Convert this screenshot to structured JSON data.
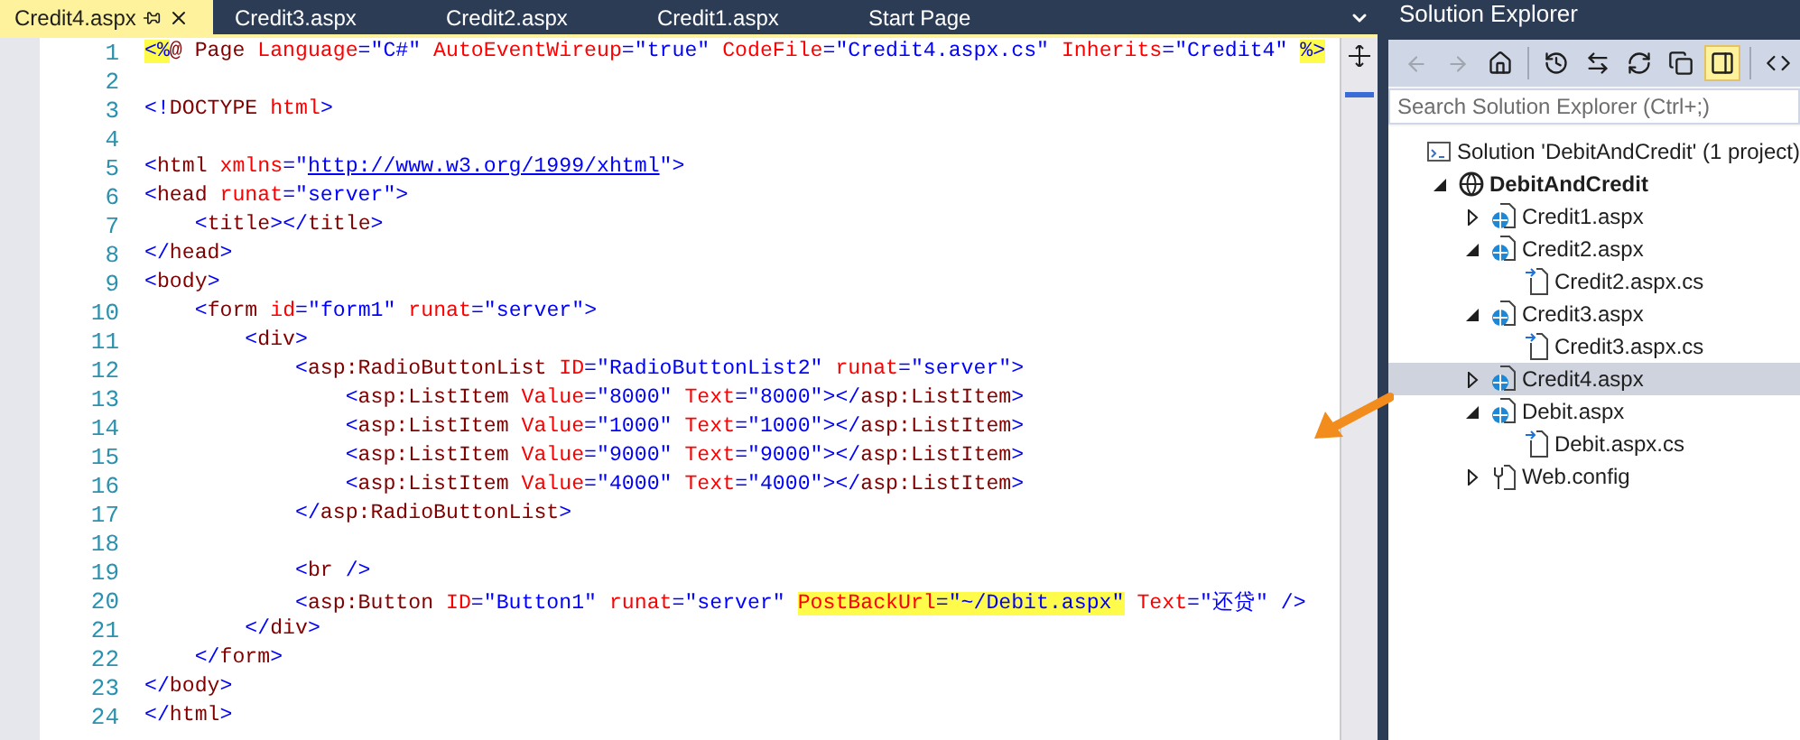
{
  "tabs": [
    {
      "label": "Credit4.aspx",
      "selected": true
    },
    {
      "label": "Credit3.aspx",
      "selected": false
    },
    {
      "label": "Credit2.aspx",
      "selected": false
    },
    {
      "label": "Credit1.aspx",
      "selected": false
    },
    {
      "label": "Start Page",
      "selected": false
    }
  ],
  "editor": {
    "lines": [
      {
        "number": "1",
        "tokens": [
          {
            "t": "<%",
            "kind": "delim",
            "hl": true
          },
          {
            "t": "@ Page ",
            "kind": "tag"
          },
          {
            "t": "Language",
            "kind": "attr"
          },
          {
            "t": "=\"C#\" ",
            "kind": "value"
          },
          {
            "t": "AutoEventWireup",
            "kind": "attr"
          },
          {
            "t": "=\"true\" ",
            "kind": "value"
          },
          {
            "t": "CodeFile",
            "kind": "attr"
          },
          {
            "t": "=\"Credit4.aspx.cs\" ",
            "kind": "value"
          },
          {
            "t": "Inherits",
            "kind": "attr"
          },
          {
            "t": "=\"Credit4\" ",
            "kind": "value"
          },
          {
            "t": "%>",
            "kind": "delim",
            "hl": true
          }
        ]
      },
      {
        "number": "2"
      },
      {
        "number": "3",
        "tokens": [
          {
            "t": "<!",
            "kind": "delim"
          },
          {
            "t": "DOCTYPE ",
            "kind": "tag"
          },
          {
            "t": "html",
            "kind": "attr"
          },
          {
            "t": ">",
            "kind": "delim"
          }
        ]
      },
      {
        "number": "4"
      },
      {
        "number": "5",
        "tokens": [
          {
            "t": "<",
            "kind": "delim"
          },
          {
            "t": "html ",
            "kind": "tag"
          },
          {
            "t": "xmlns",
            "kind": "attr"
          },
          {
            "t": "=\"",
            "kind": "value"
          },
          {
            "t": "http://www.w3.org/1999/xhtml",
            "kind": "link"
          },
          {
            "t": "\">",
            "kind": "value"
          }
        ]
      },
      {
        "number": "6",
        "tokens": [
          {
            "t": "<",
            "kind": "delim"
          },
          {
            "t": "head ",
            "kind": "tag"
          },
          {
            "t": "runat",
            "kind": "attr"
          },
          {
            "t": "=\"server\">",
            "kind": "value"
          }
        ]
      },
      {
        "number": "7",
        "tokens": [
          {
            "t": "    <",
            "kind": "delim"
          },
          {
            "t": "title",
            "kind": "tag"
          },
          {
            "t": "></",
            "kind": "delim"
          },
          {
            "t": "title",
            "kind": "tag"
          },
          {
            "t": ">",
            "kind": "delim"
          }
        ]
      },
      {
        "number": "8",
        "tokens": [
          {
            "t": "</",
            "kind": "delim"
          },
          {
            "t": "head",
            "kind": "tag"
          },
          {
            "t": ">",
            "kind": "delim"
          }
        ]
      },
      {
        "number": "9",
        "tokens": [
          {
            "t": "<",
            "kind": "delim"
          },
          {
            "t": "body",
            "kind": "tag"
          },
          {
            "t": ">",
            "kind": "delim"
          }
        ]
      },
      {
        "number": "10",
        "tokens": [
          {
            "t": "    <",
            "kind": "delim"
          },
          {
            "t": "form ",
            "kind": "tag"
          },
          {
            "t": "id",
            "kind": "attr"
          },
          {
            "t": "=\"form1\" ",
            "kind": "value"
          },
          {
            "t": "runat",
            "kind": "attr"
          },
          {
            "t": "=\"server\">",
            "kind": "value"
          }
        ]
      },
      {
        "number": "11",
        "tokens": [
          {
            "t": "        <",
            "kind": "delim"
          },
          {
            "t": "div",
            "kind": "tag"
          },
          {
            "t": ">",
            "kind": "delim"
          }
        ]
      },
      {
        "number": "12",
        "tokens": [
          {
            "t": "            <",
            "kind": "delim"
          },
          {
            "t": "asp:RadioButtonList ",
            "kind": "tag"
          },
          {
            "t": "ID",
            "kind": "attr"
          },
          {
            "t": "=\"RadioButtonList2\" ",
            "kind": "value"
          },
          {
            "t": "runat",
            "kind": "attr"
          },
          {
            "t": "=\"server\">",
            "kind": "value"
          }
        ]
      },
      {
        "number": "13",
        "tokens": [
          {
            "t": "                <",
            "kind": "delim"
          },
          {
            "t": "asp:ListItem ",
            "kind": "tag"
          },
          {
            "t": "Value",
            "kind": "attr"
          },
          {
            "t": "=\"8000\" ",
            "kind": "value"
          },
          {
            "t": "Text",
            "kind": "attr"
          },
          {
            "t": "=\"8000\"></",
            "kind": "value"
          },
          {
            "t": "asp:ListItem",
            "kind": "tag"
          },
          {
            "t": ">",
            "kind": "delim"
          }
        ]
      },
      {
        "number": "14",
        "tokens": [
          {
            "t": "                <",
            "kind": "delim"
          },
          {
            "t": "asp:ListItem ",
            "kind": "tag"
          },
          {
            "t": "Value",
            "kind": "attr"
          },
          {
            "t": "=\"1000\" ",
            "kind": "value"
          },
          {
            "t": "Text",
            "kind": "attr"
          },
          {
            "t": "=\"1000\"></",
            "kind": "value"
          },
          {
            "t": "asp:ListItem",
            "kind": "tag"
          },
          {
            "t": ">",
            "kind": "delim"
          }
        ]
      },
      {
        "number": "15",
        "tokens": [
          {
            "t": "                <",
            "kind": "delim"
          },
          {
            "t": "asp:ListItem ",
            "kind": "tag"
          },
          {
            "t": "Value",
            "kind": "attr"
          },
          {
            "t": "=\"9000\" ",
            "kind": "value"
          },
          {
            "t": "Text",
            "kind": "attr"
          },
          {
            "t": "=\"9000\"></",
            "kind": "value"
          },
          {
            "t": "asp:ListItem",
            "kind": "tag"
          },
          {
            "t": ">",
            "kind": "delim"
          }
        ]
      },
      {
        "number": "16",
        "tokens": [
          {
            "t": "                <",
            "kind": "delim"
          },
          {
            "t": "asp:ListItem ",
            "kind": "tag"
          },
          {
            "t": "Value",
            "kind": "attr"
          },
          {
            "t": "=\"4000\" ",
            "kind": "value"
          },
          {
            "t": "Text",
            "kind": "attr"
          },
          {
            "t": "=\"4000\"></",
            "kind": "value"
          },
          {
            "t": "asp:ListItem",
            "kind": "tag"
          },
          {
            "t": ">",
            "kind": "delim"
          }
        ]
      },
      {
        "number": "17",
        "tokens": [
          {
            "t": "            </",
            "kind": "delim"
          },
          {
            "t": "asp:RadioButtonList",
            "kind": "tag"
          },
          {
            "t": ">",
            "kind": "delim"
          }
        ]
      },
      {
        "number": "18"
      },
      {
        "number": "19",
        "tokens": [
          {
            "t": "            <",
            "kind": "delim"
          },
          {
            "t": "br ",
            "kind": "tag"
          },
          {
            "t": "/>",
            "kind": "delim"
          }
        ]
      },
      {
        "number": "20",
        "tokens": [
          {
            "t": "            <",
            "kind": "delim"
          },
          {
            "t": "asp:Button ",
            "kind": "tag"
          },
          {
            "t": "ID",
            "kind": "attr"
          },
          {
            "t": "=\"Button1\" ",
            "kind": "value"
          },
          {
            "t": "runat",
            "kind": "attr"
          },
          {
            "t": "=\"server\" ",
            "kind": "value"
          },
          {
            "t": "PostBackUrl",
            "kind": "attr",
            "hl": true
          },
          {
            "t": "=\"~/Debit.aspx\"",
            "kind": "value",
            "hl": true
          },
          {
            "t": " Text",
            "kind": "attr"
          },
          {
            "t": "=\"还贷\" />",
            "kind": "value"
          }
        ]
      },
      {
        "number": "21",
        "tokens": [
          {
            "t": "        </",
            "kind": "delim"
          },
          {
            "t": "div",
            "kind": "tag"
          },
          {
            "t": ">",
            "kind": "delim"
          }
        ]
      },
      {
        "number": "22",
        "tokens": [
          {
            "t": "    </",
            "kind": "delim"
          },
          {
            "t": "form",
            "kind": "tag"
          },
          {
            "t": ">",
            "kind": "delim"
          }
        ]
      },
      {
        "number": "23",
        "tokens": [
          {
            "t": "</",
            "kind": "delim"
          },
          {
            "t": "body",
            "kind": "tag"
          },
          {
            "t": ">",
            "kind": "delim"
          }
        ]
      },
      {
        "number": "24",
        "tokens": [
          {
            "t": "</",
            "kind": "delim"
          },
          {
            "t": "html",
            "kind": "tag"
          },
          {
            "t": ">",
            "kind": "delim"
          }
        ]
      }
    ]
  },
  "solution_explorer": {
    "title": "Solution Explorer",
    "search": {
      "placeholder": "Search Solution Explorer (Ctrl+;)"
    },
    "tree": [
      {
        "label": "Solution 'DebitAndCredit' (1 project)",
        "kind": "solution",
        "selected": false,
        "children": [
          {
            "label": "DebitAndCredit",
            "kind": "project",
            "expanded": true,
            "selected": false,
            "children": [
              {
                "label": "Credit1.aspx",
                "kind": "page",
                "expanded": false,
                "selected": false
              },
              {
                "label": "Credit2.aspx",
                "kind": "page",
                "expanded": true,
                "selected": false,
                "children": [
                  {
                    "label": "Credit2.aspx.cs",
                    "kind": "code",
                    "selected": false
                  }
                ]
              },
              {
                "label": "Credit3.aspx",
                "kind": "page",
                "expanded": true,
                "selected": false,
                "children": [
                  {
                    "label": "Credit3.aspx.cs",
                    "kind": "code",
                    "selected": false
                  }
                ]
              },
              {
                "label": "Credit4.aspx",
                "kind": "page",
                "expanded": false,
                "selected": true
              },
              {
                "label": "Debit.aspx",
                "kind": "page",
                "expanded": true,
                "selected": false,
                "children": [
                  {
                    "label": "Debit.aspx.cs",
                    "kind": "code",
                    "selected": false
                  }
                ]
              },
              {
                "label": "Web.config",
                "kind": "config",
                "expanded": false,
                "selected": false
              }
            ]
          }
        ]
      }
    ]
  }
}
